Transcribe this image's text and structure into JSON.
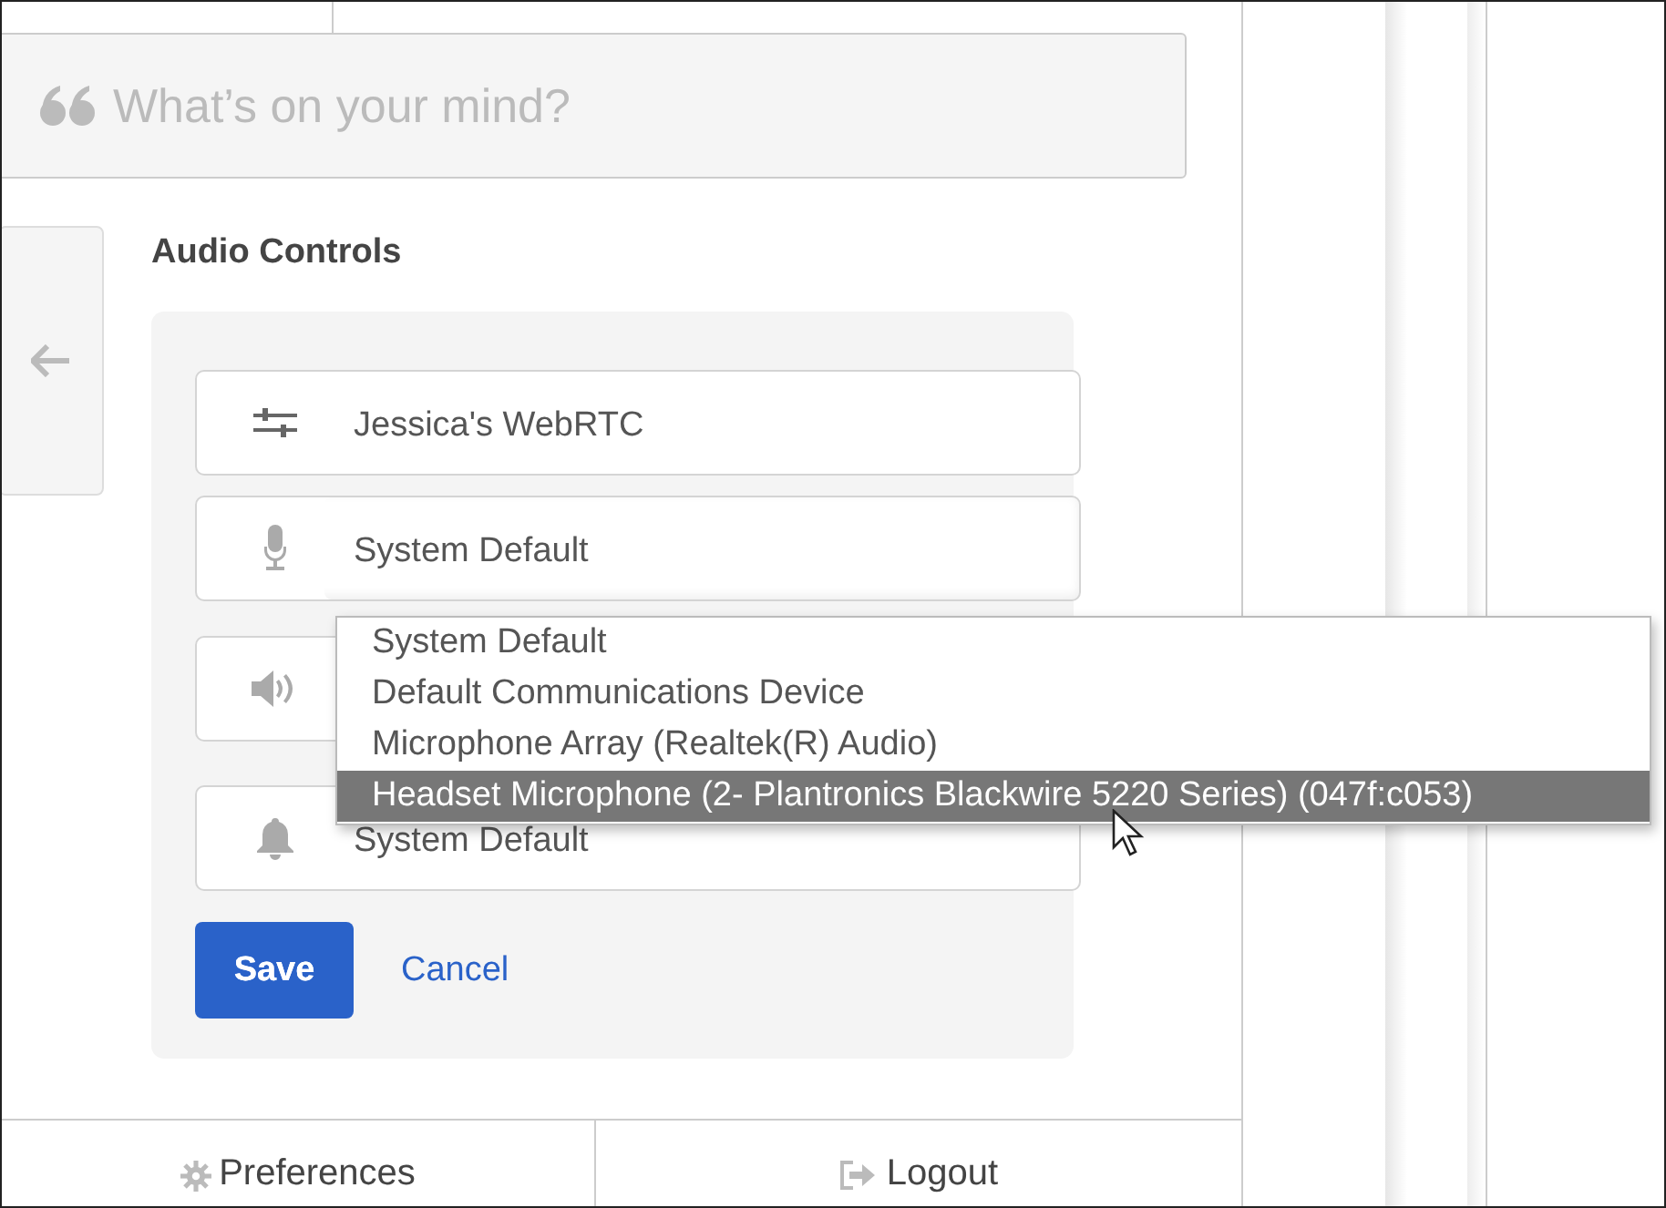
{
  "composer": {
    "placeholder": "What’s on your mind?"
  },
  "audio_controls": {
    "title": "Audio Controls",
    "fields": [
      {
        "value": "Jessica's WebRTC",
        "expanded": false
      },
      {
        "value": "System Default",
        "expanded": true
      },
      {
        "expanded": false
      },
      {
        "value": "System Default",
        "expanded": false
      }
    ],
    "dropdown": [
      {
        "label": "System Default",
        "selected": false
      },
      {
        "label": "Default Communications Device",
        "selected": false
      },
      {
        "label": "Microphone Array (Realtek(R) Audio)",
        "selected": false
      },
      {
        "label": "Headset Microphone (2- Plantronics Blackwire 5220 Series) (047f:c053)",
        "selected": true
      }
    ],
    "save": "Save",
    "cancel": "Cancel"
  },
  "footer": [
    {
      "label": "Preferences"
    },
    {
      "label": "Logout"
    }
  ]
}
